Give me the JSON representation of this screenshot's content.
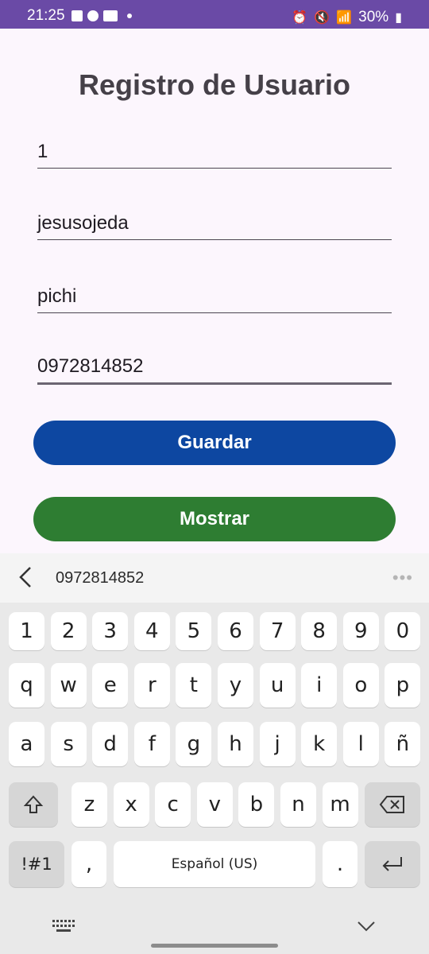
{
  "status_bar": {
    "time": "21:25",
    "battery": "30%"
  },
  "form": {
    "title": "Registro de Usuario",
    "fields": [
      "1",
      "jesusojeda",
      "pichi",
      "0972814852"
    ],
    "buttons": {
      "save": "Guardar",
      "show": "Mostrar"
    }
  },
  "colors": {
    "save_button": "#0d47a1",
    "show_button": "#2e7d32",
    "status_bar": "#6a4aa6"
  },
  "keyboard": {
    "suggestion": "0972814852",
    "row_numbers": [
      "1",
      "2",
      "3",
      "4",
      "5",
      "6",
      "7",
      "8",
      "9",
      "0"
    ],
    "row1": [
      "q",
      "w",
      "e",
      "r",
      "t",
      "y",
      "u",
      "i",
      "o",
      "p"
    ],
    "row2": [
      "a",
      "s",
      "d",
      "f",
      "g",
      "h",
      "j",
      "k",
      "l",
      "ñ"
    ],
    "row3": [
      "z",
      "x",
      "c",
      "v",
      "b",
      "n",
      "m"
    ],
    "symbols_label": "!#1",
    "comma": ",",
    "space_label": "Español (US)",
    "period": ".",
    "icons": [
      "back-chevron-icon",
      "more-dots-icon",
      "shift-icon",
      "backspace-icon",
      "enter-icon",
      "keyboard-grid-icon",
      "hide-keyboard-icon"
    ]
  }
}
